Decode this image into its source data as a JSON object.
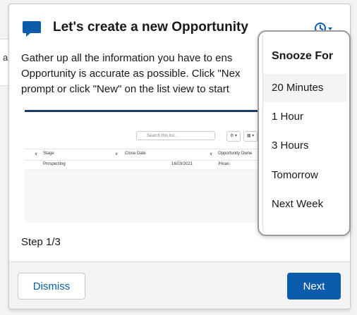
{
  "background": {
    "left_char": "a",
    "right_char": ""
  },
  "dialog": {
    "title": "Let's create a new Opportunity",
    "body_lines": [
      "Gather up all the information you have to ens",
      "Opportunity is accurate as possible. Click \"Nex",
      "prompt or click \"New\" on the list view to start"
    ],
    "step": "Step 1/3",
    "icons": {
      "title": "chat-bubble-icon",
      "snooze": "clock-icon",
      "caret": "chevron-down-icon"
    }
  },
  "preview": {
    "search_placeholder": "Search this list...",
    "toolbar_buttons": [
      "⚙ ▾",
      "▦ ▾",
      "C"
    ],
    "columns": [
      "Stage",
      "Close Date",
      "Opportunity Owne"
    ],
    "rows": [
      {
        "stage": "Prospecting",
        "close_date": "16/03/2021",
        "owner": "/Hoan"
      }
    ]
  },
  "footer": {
    "dismiss_label": "Dismiss",
    "next_label": "Next"
  },
  "snooze_menu": {
    "heading": "Snooze For",
    "items": [
      "20 Minutes",
      "1 Hour",
      "3 Hours",
      "Tomorrow",
      "Next Week"
    ],
    "highlighted_index": 0
  },
  "colors": {
    "brand": "#0b5cab",
    "preview_bar": "#1b3a68"
  }
}
